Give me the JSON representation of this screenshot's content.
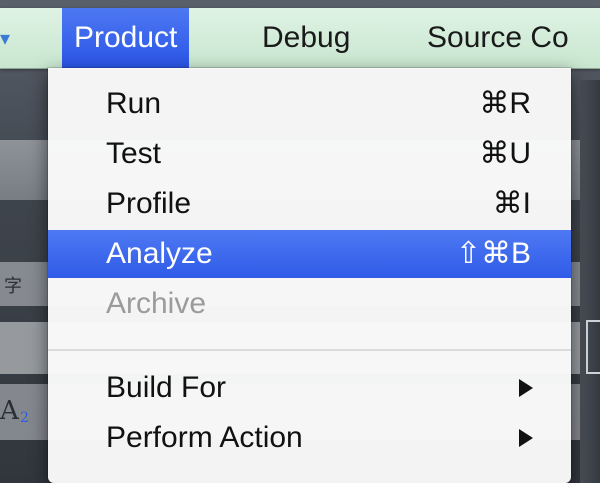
{
  "menubar": {
    "items": [
      {
        "label": "Product"
      },
      {
        "label": "Debug"
      },
      {
        "label": "Source Co"
      }
    ]
  },
  "menu": {
    "items": [
      {
        "label": "Run",
        "shortcut": "⌘R"
      },
      {
        "label": "Test",
        "shortcut": "⌘U"
      },
      {
        "label": "Profile",
        "shortcut": "⌘I"
      },
      {
        "label": "Analyze",
        "shortcut": "⇧⌘B"
      },
      {
        "label": "Archive",
        "shortcut": ""
      },
      {
        "label": "Build For",
        "shortcut": ""
      },
      {
        "label": "Perform Action",
        "shortcut": ""
      }
    ]
  },
  "background": {
    "glyph_1": "字",
    "glyph_2": "A",
    "glyph_3": "2"
  },
  "colors": {
    "highlight": "#2f5be8",
    "menubar": "#c8e6cf",
    "disabled": "#9b9b9b"
  }
}
